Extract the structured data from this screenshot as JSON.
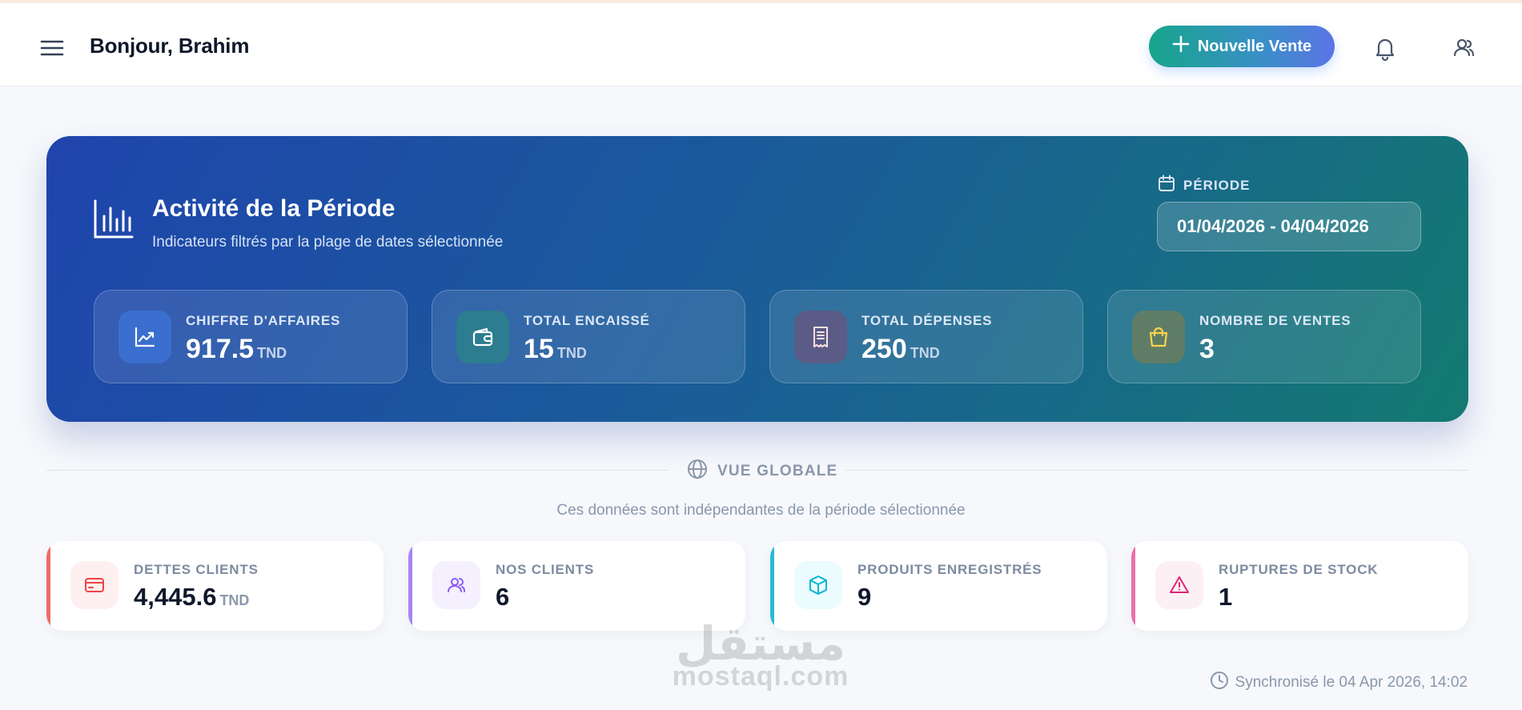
{
  "header": {
    "greeting": "Bonjour, Brahim",
    "new_sale_label": "Nouvelle Vente",
    "icons": [
      "menu-icon",
      "plus-icon",
      "bell-icon",
      "user-icon"
    ]
  },
  "hero": {
    "title": "Activité de la Période",
    "subtitle": "Indicateurs filtrés par la plage de dates sélectionnée",
    "period_label": "PÉRIODE",
    "period_value": "01/04/2026 - 04/04/2026",
    "stats": [
      {
        "label": "CHIFFRE D'AFFAIRES",
        "value": "917.5",
        "unit": "TND",
        "icon": "trend-icon"
      },
      {
        "label": "TOTAL ENCAISSÉ",
        "value": "15",
        "unit": "TND",
        "icon": "wallet-icon"
      },
      {
        "label": "TOTAL DÉPENSES",
        "value": "250",
        "unit": "TND",
        "icon": "receipt-icon"
      },
      {
        "label": "NOMBRE DE VENTES",
        "value": "3",
        "unit": "",
        "icon": "shopping-bag-icon"
      }
    ]
  },
  "global": {
    "title": "VUE GLOBALE",
    "subtitle": "Ces données sont indépendantes de la période sélectionnée",
    "cards": [
      {
        "label": "DETTES CLIENTS",
        "value": "4,445.6",
        "unit": "TND",
        "icon": "credit-card-icon",
        "accent": "#ef4444"
      },
      {
        "label": "NOS CLIENTS",
        "value": "6",
        "unit": "",
        "icon": "users-icon",
        "accent": "#8b5cf6"
      },
      {
        "label": "PRODUITS ENREGISTRÉS",
        "value": "9",
        "unit": "",
        "icon": "box-icon",
        "accent": "#06b6d4"
      },
      {
        "label": "RUPTURES DE STOCK",
        "value": "1",
        "unit": "",
        "icon": "warning-icon",
        "accent": "#ec4899"
      }
    ]
  },
  "sync_text": "Synchronisé le 04 Apr 2026, 14:02",
  "watermark": {
    "arabic": "مستقل",
    "latin": "mostaql.com"
  },
  "colors": {
    "hero_gradient_start": "#1f44ad",
    "hero_gradient_end": "#137a70",
    "button_gradient_start": "#16a58a",
    "button_gradient_end": "#5b74e6"
  }
}
